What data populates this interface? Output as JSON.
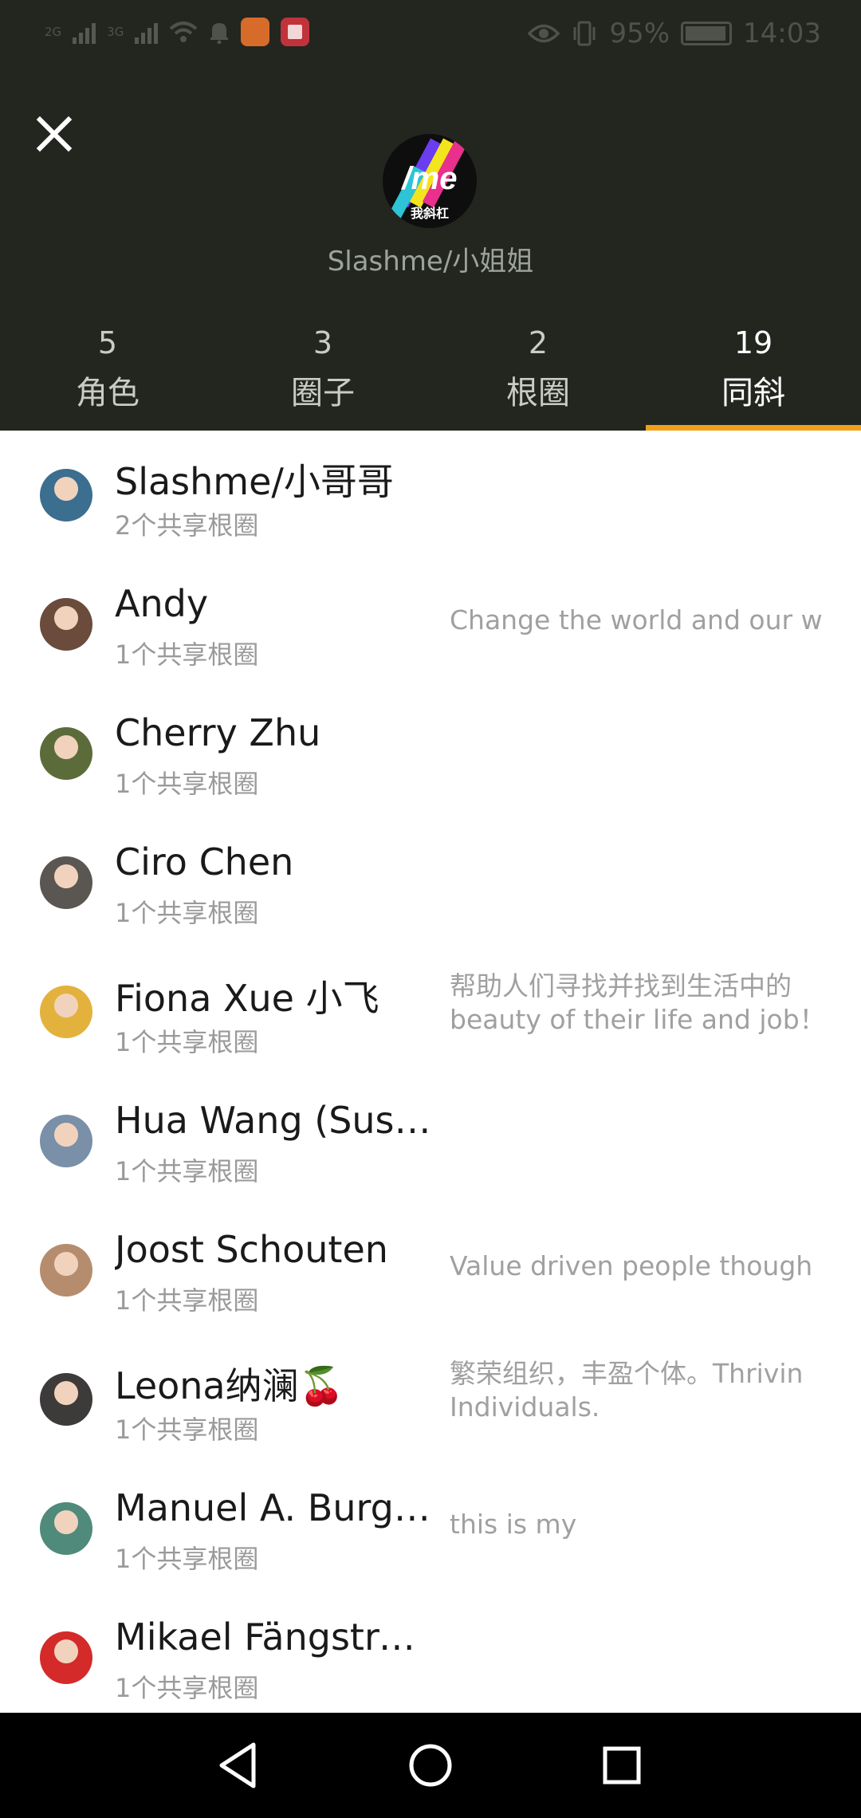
{
  "status_bar": {
    "network_1": "2G",
    "network_2": "3G",
    "battery": "95%",
    "time": "14:03"
  },
  "profile": {
    "logo_text": "/me",
    "logo_sub": "我斜杠",
    "name": "Slashme/小姐姐"
  },
  "tabs": [
    {
      "count": "5",
      "label": "角色"
    },
    {
      "count": "3",
      "label": "圈子"
    },
    {
      "count": "2",
      "label": "根圈"
    },
    {
      "count": "19",
      "label": "同斜",
      "active": true
    }
  ],
  "contacts": [
    {
      "name": "Slashme/小哥哥",
      "sub": "2个共享根圈",
      "bio": "",
      "avatar_color": "#3b6e8f"
    },
    {
      "name": "Andy",
      "sub": "1个共享根圈",
      "bio": "Change the world and our wo",
      "avatar_color": "#6a4b3c"
    },
    {
      "name": "Cherry Zhu",
      "sub": "1个共享根圈",
      "bio": "",
      "avatar_color": "#5c6b3a"
    },
    {
      "name": "Ciro Chen",
      "sub": "1个共享根圈",
      "bio": "",
      "avatar_color": "#5a5652"
    },
    {
      "name": "Fiona Xue 小飞",
      "sub": "1个共享根圈",
      "bio": "帮助人们寻找并找到生活中的",
      "bio2": "beauty of their life and job！",
      "avatar_color": "#e3b23c"
    },
    {
      "name": "Hua Wang (Susa...",
      "sub": "1个共享根圈",
      "bio": "",
      "avatar_color": "#7a8fa8"
    },
    {
      "name": "Joost Schouten",
      "sub": "1个共享根圈",
      "bio": "Value driven people though pu",
      "avatar_color": "#b58d6e"
    },
    {
      "name": "Leona纳澜🍒",
      "sub": "1个共享根圈",
      "bio": "繁荣组织，丰盈个体。Thrivin",
      "bio2": "Individuals.",
      "avatar_color": "#3d3a3a"
    },
    {
      "name": "Manuel A. Burgos",
      "sub": "1个共享根圈",
      "bio": "this is my",
      "avatar_color": "#4f8a7a"
    },
    {
      "name": "Mikael Fängström",
      "sub": "1个共享根圈",
      "bio": "",
      "avatar_color": "#d42a2a"
    }
  ]
}
